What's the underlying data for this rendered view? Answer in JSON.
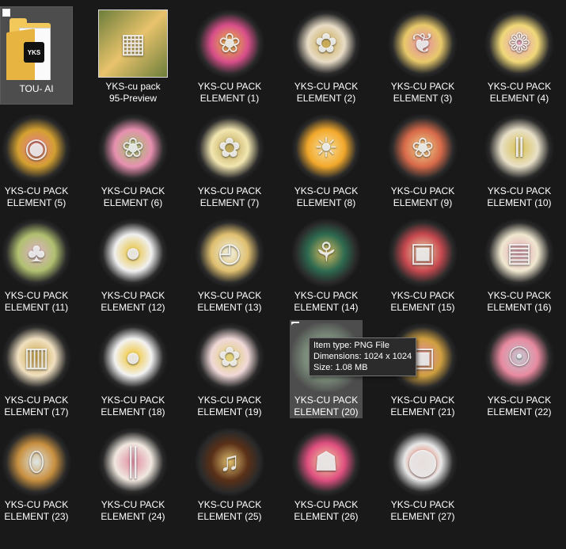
{
  "items": [
    {
      "label": "TOU- AI",
      "icon": "folder-icon",
      "kind": "folder",
      "selected": true,
      "checkbox": true
    },
    {
      "label": "YKS-cu pack 95-Preview",
      "icon": "preview-collage-icon",
      "kind": "preview",
      "accent": "#6b7d3a",
      "accent2": "#e8c36c"
    },
    {
      "label": "YKS-CU PACK ELEMENT (1)",
      "icon": "butterfly-icon",
      "accent": "#d94f8a",
      "accent2": "#e6c13c"
    },
    {
      "label": "YKS-CU PACK ELEMENT (2)",
      "icon": "flower-bouquet-icon",
      "accent": "#e8dcc6",
      "accent2": "#c7a64a"
    },
    {
      "label": "YKS-CU PACK ELEMENT (3)",
      "icon": "sweet-moments-banner-icon",
      "accent": "#e8c96a",
      "accent2": "#e28aa8"
    },
    {
      "label": "YKS-CU PACK ELEMENT (4)",
      "icon": "floral-wings-icon",
      "accent": "#f0d878",
      "accent2": "#e5a0c0"
    },
    {
      "label": "YKS-CU PACK ELEMENT (5)",
      "icon": "camera-icon",
      "accent": "#d4a030",
      "accent2": "#e8789a"
    },
    {
      "label": "YKS-CU PACK ELEMENT (6)",
      "icon": "butterfly-icon",
      "accent": "#e890b0",
      "accent2": "#9ac86a"
    },
    {
      "label": "YKS-CU PACK ELEMENT (7)",
      "icon": "flower-bouquet-icon",
      "accent": "#f2e6b0",
      "accent2": "#b8a050"
    },
    {
      "label": "YKS-CU PACK ELEMENT (8)",
      "icon": "sun-icon",
      "accent": "#f2a82a",
      "accent2": "#f8e4a8",
      "round": true
    },
    {
      "label": "YKS-CU PACK ELEMENT (9)",
      "icon": "flower-arch-icon",
      "accent": "#d86a4a",
      "accent2": "#f0d890"
    },
    {
      "label": "YKS-CU PACK ELEMENT (10)",
      "icon": "garden-fence-icon",
      "accent": "#e8e0c8",
      "accent2": "#d8c050"
    },
    {
      "label": "YKS-CU PACK ELEMENT (11)",
      "icon": "flower-tree-icon",
      "accent": "#b0c070",
      "accent2": "#e0b0c8"
    },
    {
      "label": "YKS-CU PACK ELEMENT (12)",
      "icon": "teddy-bear-icon",
      "accent": "#f0f0f0",
      "accent2": "#e8c030"
    },
    {
      "label": "YKS-CU PACK ELEMENT (13)",
      "icon": "alarm-clock-icon",
      "accent": "#e0c070",
      "accent2": "#f0f0e0"
    },
    {
      "label": "YKS-CU PACK ELEMENT (14)",
      "icon": "flower-vases-icon",
      "accent": "#2e6a50",
      "accent2": "#e0c060"
    },
    {
      "label": "YKS-CU PACK ELEMENT (15)",
      "icon": "gift-box-icon",
      "accent": "#c84a50",
      "accent2": "#f0e0b0"
    },
    {
      "label": "YKS-CU PACK ELEMENT (16)",
      "icon": "cabinet-icon",
      "accent": "#f0e8d0",
      "accent2": "#e0a0b0"
    },
    {
      "label": "YKS-CU PACK ELEMENT (17)",
      "icon": "wardrobe-icon",
      "accent": "#f0e0c0",
      "accent2": "#c8a040"
    },
    {
      "label": "YKS-CU PACK ELEMENT (18)",
      "icon": "puppy-icon",
      "accent": "#f2f2f2",
      "accent2": "#f0c020"
    },
    {
      "label": "YKS-CU PACK ELEMENT (19)",
      "icon": "flower-bouquet-icon",
      "accent": "#f0d8d8",
      "accent2": "#e0d070"
    },
    {
      "label": "YKS-CU PACK ELEMENT (20)",
      "icon": "flower-bouquet-icon",
      "accent": "#7a8a7a",
      "accent2": "#b0b8b0",
      "hovered": true,
      "checkbox": true
    },
    {
      "label": "YKS-CU PACK ELEMENT (21)",
      "icon": "gift-box-icon",
      "accent": "#d0a040",
      "accent2": "#e890a8"
    },
    {
      "label": "YKS-CU PACK ELEMENT (22)",
      "icon": "hand-mirror-icon",
      "accent": "#e88aa0",
      "accent2": "#c0c8d0"
    },
    {
      "label": "YKS-CU PACK ELEMENT (23)",
      "icon": "mirror-icon",
      "accent": "#c89040",
      "accent2": "#e0e8e8"
    },
    {
      "label": "YKS-CU PACK ELEMENT (24)",
      "icon": "columns-icon",
      "accent": "#f0e8e0",
      "accent2": "#e08aa0"
    },
    {
      "label": "YKS-CU PACK ELEMENT (25)",
      "icon": "piano-icon",
      "accent": "#5a3018",
      "accent2": "#e0c070"
    },
    {
      "label": "YKS-CU PACK ELEMENT (26)",
      "icon": "cake-icon",
      "accent": "#e05080",
      "accent2": "#f0d8a0"
    },
    {
      "label": "YKS-CU PACK ELEMENT (27)",
      "icon": "candy-jar-icon",
      "accent": "#e8e8e8",
      "accent2": "#e86040"
    }
  ],
  "tooltip": {
    "type": "Item type: PNG File",
    "dimensions": "Dimensions: 1024 x 1024",
    "size": "Size: 1.08 MB"
  },
  "colors": {
    "background": "#191919",
    "selected": "#4d4d4d",
    "text": "#ffffff"
  }
}
